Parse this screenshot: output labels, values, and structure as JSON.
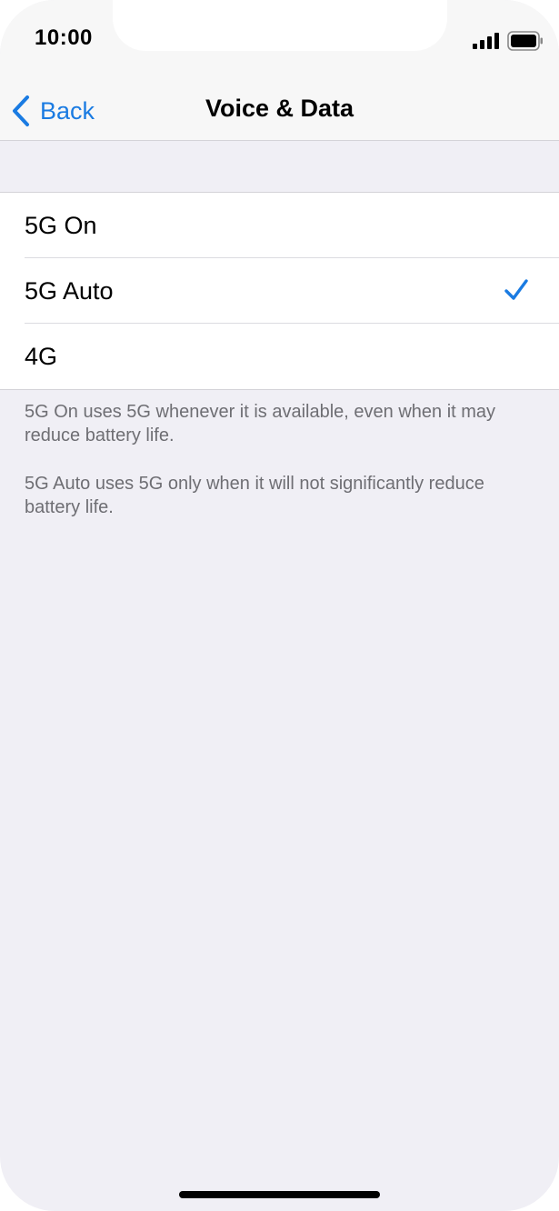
{
  "status_bar": {
    "time": "10:00",
    "signal_icon": "cellular-signal-icon",
    "battery_icon": "battery-full-icon"
  },
  "nav": {
    "back_label": "Back",
    "back_icon": "chevron-left-icon",
    "title": "Voice & Data"
  },
  "options": [
    {
      "label": "5G On",
      "selected": false
    },
    {
      "label": "5G Auto",
      "selected": true
    },
    {
      "label": "4G",
      "selected": false
    }
  ],
  "footer": {
    "note_1": "5G On uses 5G whenever it is available, even when it may reduce battery life.",
    "note_2": "5G Auto uses 5G only when it will not significantly reduce battery life."
  },
  "colors": {
    "accent": "#1a7be2",
    "background": "#f0eff5",
    "secondary_text": "#6e6e73"
  }
}
